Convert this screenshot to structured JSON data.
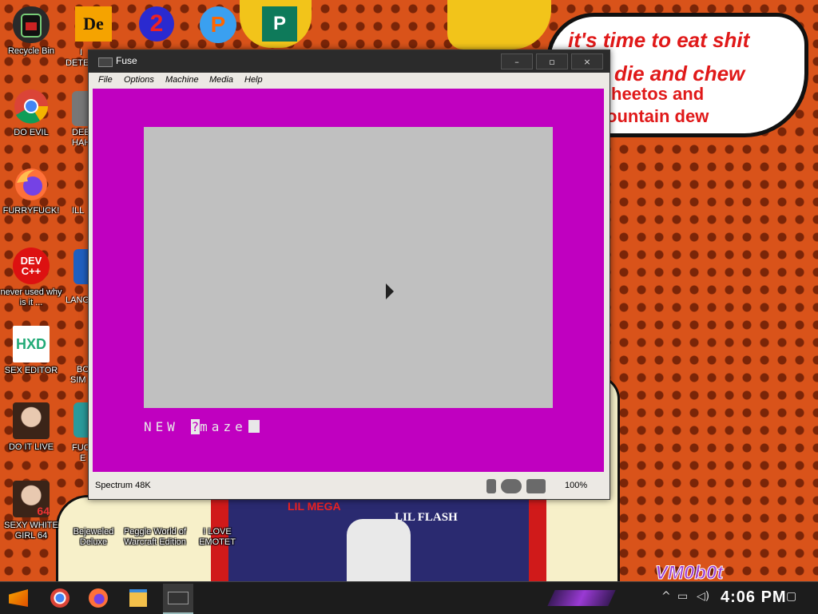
{
  "desktop": {
    "speech_bubble": {
      "line1": "it's time to eat shit",
      "line2": "die and chew",
      "line3": "heetos and",
      "line4": "ountain dew"
    },
    "album": {
      "title": "LIL MEGA",
      "artist": "LIL FLASH"
    },
    "watermark": "VM0b0t",
    "icons": [
      {
        "label": "Recycle Bin",
        "icon": "recycle-bin-icon"
      },
      {
        "label": "DO EVIL",
        "icon": "chrome-icon"
      },
      {
        "label": "FURRYFUCK!",
        "icon": "firefox-icon"
      },
      {
        "label": "never used why is it ...",
        "icon": "dev-cpp-icon",
        "icon_text": "DEV C++"
      },
      {
        "label": "SEX EDITOR",
        "icon": "hxd-icon",
        "icon_text": "HXD"
      },
      {
        "label": "DO IT LIVE",
        "icon": "portrait-icon"
      },
      {
        "label": "SEXY WHITE GIRL 64",
        "icon": "portrait-64-icon",
        "icon_text": "64"
      },
      {
        "label": "Bejeweled Deluxe",
        "icon": "bejeweled-icon"
      },
      {
        "label": "Peggle World of Warcraft Edition",
        "icon": "peggle-icon"
      },
      {
        "label": "I LOVE EMOTET",
        "icon": "emotet-icon"
      }
    ],
    "partial_labels": [
      "I",
      "DETE",
      "DEE",
      "HAH",
      "ILL",
      "LANG",
      "BO",
      "SIM",
      "FUC",
      "E"
    ]
  },
  "window": {
    "title": "Fuse",
    "controls": {
      "minimize": "–",
      "maximize": "▫",
      "close": "×"
    },
    "menu": [
      "File",
      "Options",
      "Machine",
      "Media",
      "Help"
    ],
    "screen": {
      "border_color": "#c000c0",
      "paper_color": "#c0c0c0",
      "basic_prefix": "NEW ",
      "basic_inverse": "?",
      "basic_rest": "maze"
    },
    "status": {
      "model": "Spectrum 48K",
      "zoom": "100%",
      "icons": [
        "mouse-icon",
        "joystick-icon",
        "tape-icon"
      ]
    }
  },
  "taskbar": {
    "apps": [
      "start-icon",
      "chrome-icon",
      "firefox-icon",
      "file-explorer-icon",
      "fuse-icon"
    ],
    "tray_chevron": "^",
    "clock": "4:06 PM"
  }
}
